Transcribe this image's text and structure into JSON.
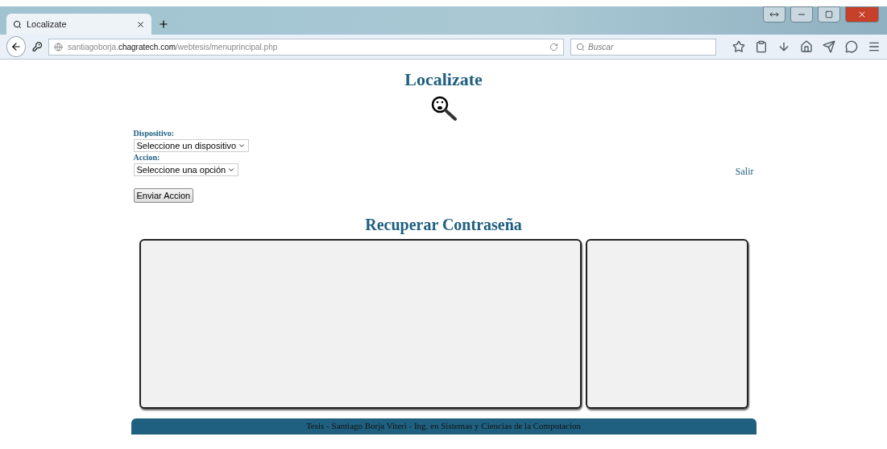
{
  "browser": {
    "tabs": [
      {
        "title": "Localizate",
        "selected": true
      }
    ],
    "url": {
      "host_prefix": "santiagoborja.",
      "domain": "chagratech.com",
      "path": "/webtesis/menuprincipal.php"
    },
    "search": {
      "placeholder": "Buscar"
    }
  },
  "page": {
    "title": "Localizate",
    "form": {
      "fields": [
        {
          "label": "Dispositivo:",
          "value": "Seleccione un dispositivo"
        },
        {
          "label": "Accion:",
          "value": "Seleccione una opción"
        }
      ],
      "submit": "Enviar Accion"
    },
    "logout": "Salir",
    "section_title": "Recuperar Contraseña",
    "footer": "Tesis - Santiago Borja Viteri - Ing. en Sistemas y Ciencias de la Computacion"
  }
}
